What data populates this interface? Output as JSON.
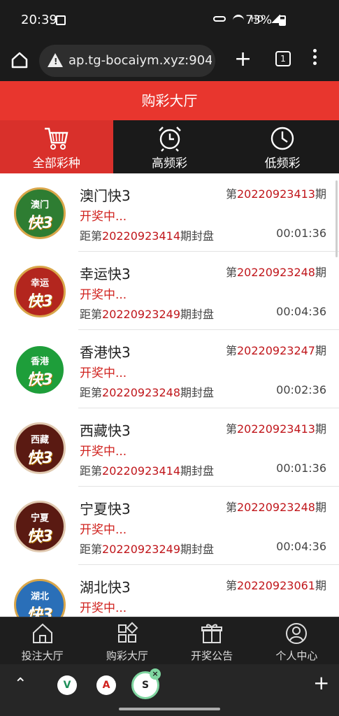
{
  "statusbar": {
    "time": "20:39",
    "hd": "HD",
    "battery": "73%"
  },
  "browser": {
    "url": "ap.tg-bocaiym.xyz:904",
    "tab_count": "1"
  },
  "header": {
    "title": "购彩大厅"
  },
  "categories": [
    {
      "label": "全部彩种",
      "icon": "cart-icon",
      "active": true
    },
    {
      "label": "高频彩",
      "icon": "alarm-clock-icon",
      "active": false
    },
    {
      "label": "低频彩",
      "icon": "clock-icon",
      "active": false
    }
  ],
  "list": [
    {
      "name": "澳门快3",
      "logo_top": "澳门",
      "logo_main": "快3",
      "logo_color": "#2e7d32",
      "issue_prefix": "第",
      "issue": "20220923413",
      "issue_suffix": "期",
      "status": "开奖中...",
      "close_prefix": "距第",
      "close_issue": "20220923414",
      "close_suffix": "期封盘",
      "countdown": "00:01:36"
    },
    {
      "name": "幸运快3",
      "logo_top": "幸运",
      "logo_main": "快3",
      "logo_color": "#b3261e",
      "issue_prefix": "第",
      "issue": "20220923248",
      "issue_suffix": "期",
      "status": "开奖中...",
      "close_prefix": "距第",
      "close_issue": "20220923249",
      "close_suffix": "期封盘",
      "countdown": "00:04:36"
    },
    {
      "name": "香港快3",
      "logo_top": "香港",
      "logo_main": "快3",
      "logo_color": "#1e9e3a",
      "issue_prefix": "第",
      "issue": "20220923247",
      "issue_suffix": "期",
      "status": "开奖中...",
      "close_prefix": "距第",
      "close_issue": "20220923248",
      "close_suffix": "期封盘",
      "countdown": "00:02:36"
    },
    {
      "name": "西藏快3",
      "logo_top": "西藏",
      "logo_main": "快3",
      "logo_color": "#5a1a12",
      "issue_prefix": "第",
      "issue": "20220923413",
      "issue_suffix": "期",
      "status": "开奖中...",
      "close_prefix": "距第",
      "close_issue": "20220923414",
      "close_suffix": "期封盘",
      "countdown": "00:01:36"
    },
    {
      "name": "宁夏快3",
      "logo_top": "宁夏",
      "logo_main": "快3",
      "logo_color": "#5a1a12",
      "issue_prefix": "第",
      "issue": "20220923248",
      "issue_suffix": "期",
      "status": "开奖中...",
      "close_prefix": "距第",
      "close_issue": "20220923249",
      "close_suffix": "期封盘",
      "countdown": "00:04:36"
    },
    {
      "name": "湖北快3",
      "logo_top": "湖北",
      "logo_main": "快3",
      "logo_color": "#2a6fb8",
      "issue_prefix": "第",
      "issue": "20220923061",
      "issue_suffix": "期",
      "status": "开奖中...",
      "close_prefix": "",
      "close_issue": "",
      "close_suffix": "",
      "countdown": ""
    }
  ],
  "bottomnav": [
    {
      "label": "投注大厅",
      "icon": "home-icon"
    },
    {
      "label": "购彩大厅",
      "icon": "grid-icon"
    },
    {
      "label": "开奖公告",
      "icon": "gift-icon"
    },
    {
      "label": "个人中心",
      "icon": "user-icon"
    }
  ],
  "sysbar": {
    "apps": [
      {
        "letter": "V",
        "icon": "app-v-icon"
      },
      {
        "letter": "A",
        "icon": "app-a-icon"
      },
      {
        "letter": "S",
        "icon": "app-s-icon"
      }
    ]
  },
  "colors": {
    "brand_red": "#e8362e",
    "active_tab_red": "#d9302b",
    "issue_red": "#c0161b"
  }
}
